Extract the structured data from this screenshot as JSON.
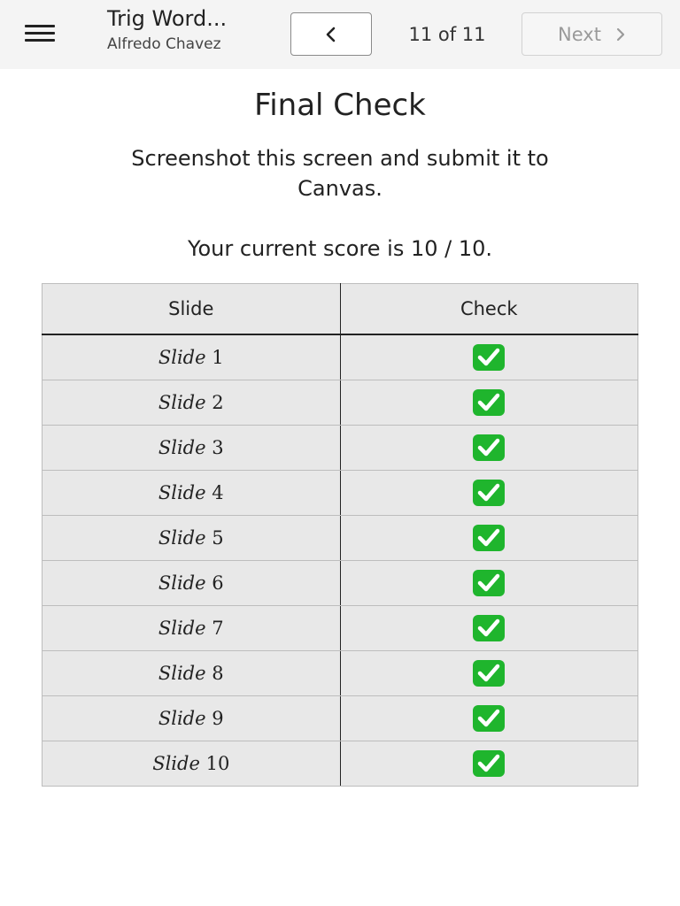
{
  "header": {
    "title": "Trig Word...",
    "author": "Alfredo Chavez",
    "page_counter": "11 of 11",
    "next_label": "Next"
  },
  "colors": {
    "check_fill": "#1fb52d",
    "topbar_bg": "#f4f4f4",
    "table_bg": "#e8e8e8"
  },
  "main": {
    "title": "Final Check",
    "instructions": "Screenshot this screen and submit it to Canvas.",
    "score_text": "Your current score is 10 / 10."
  },
  "table": {
    "columns": [
      "Slide",
      "Check"
    ],
    "rows": [
      {
        "word": "Slide",
        "num": "1",
        "checked": true
      },
      {
        "word": "Slide",
        "num": "2",
        "checked": true
      },
      {
        "word": "Slide",
        "num": "3",
        "checked": true
      },
      {
        "word": "Slide",
        "num": "4",
        "checked": true
      },
      {
        "word": "Slide",
        "num": "5",
        "checked": true
      },
      {
        "word": "Slide",
        "num": "6",
        "checked": true
      },
      {
        "word": "Slide",
        "num": "7",
        "checked": true
      },
      {
        "word": "Slide",
        "num": "8",
        "checked": true
      },
      {
        "word": "Slide",
        "num": "9",
        "checked": true
      },
      {
        "word": "Slide",
        "num": "10",
        "checked": true
      }
    ]
  }
}
